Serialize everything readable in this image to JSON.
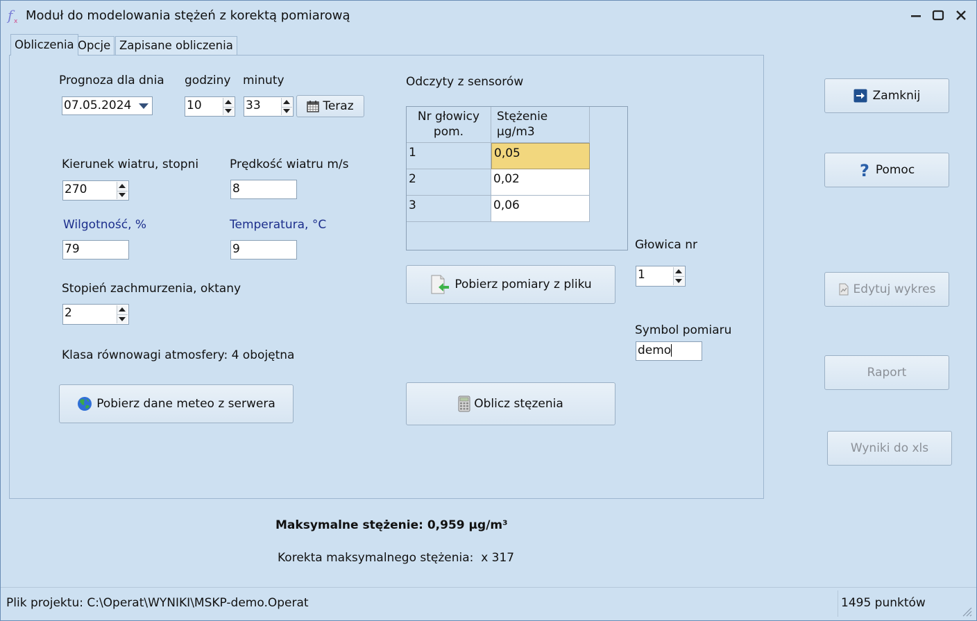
{
  "window": {
    "title": "Moduł do modelowania stężeń z korektą pomiarową"
  },
  "tabs": [
    {
      "label": "Obliczenia"
    },
    {
      "label": "Opcje"
    },
    {
      "label": "Zapisane obliczenia"
    }
  ],
  "forecast": {
    "date_label": "Prognoza dla dnia",
    "date_value": "07.05.2024",
    "hours_label": "godziny",
    "hours_value": "10",
    "minutes_label": "minuty",
    "minutes_value": "33",
    "now_button": "Teraz"
  },
  "meteo": {
    "wind_dir_label": "Kierunek wiatru, stopni",
    "wind_dir_value": "270",
    "wind_speed_label": "Prędkość wiatru m/s",
    "wind_speed_value": "8",
    "humidity_label": "Wilgotność, %",
    "humidity_value": "79",
    "temperature_label": "Temperatura, °C",
    "temperature_value": "9",
    "cloud_label": "Stopień zachmurzenia, oktany",
    "cloud_value": "2",
    "stability_text": "Klasa równowagi atmosfery: 4 obojętna",
    "fetch_meteo_button": "Pobierz dane meteo z serwera"
  },
  "sensors": {
    "title": "Odczyty z sensorów",
    "col_head": "Nr głowicy pom.",
    "col_conc": "Stężenie µg/m3",
    "rows": [
      {
        "head": "1",
        "conc": "0,05"
      },
      {
        "head": "2",
        "conc": "0,02"
      },
      {
        "head": "3",
        "conc": "0,06"
      }
    ],
    "fetch_file_button": "Pobierz pomiary z pliku",
    "compute_button": "Oblicz stęzenia"
  },
  "head_select": {
    "label": "Głowica nr",
    "value": "1"
  },
  "measurement": {
    "symbol_label": "Symbol pomiaru",
    "symbol_value": "demo"
  },
  "side_buttons": {
    "close": "Zamknij",
    "help": "Pomoc",
    "edit_chart": "Edytuj wykres",
    "report": "Raport",
    "export_xls": "Wyniki do xls"
  },
  "results": {
    "max_conc": "Maksymalne stężenie: 0,959 µg/m³",
    "correction": "Korekta maksymalnego stężenia:  x 317"
  },
  "status": {
    "project_file": "Plik projektu: C:\\Operat\\WYNIKI\\MSKP-demo.Operat",
    "points": "1495 punktów"
  }
}
